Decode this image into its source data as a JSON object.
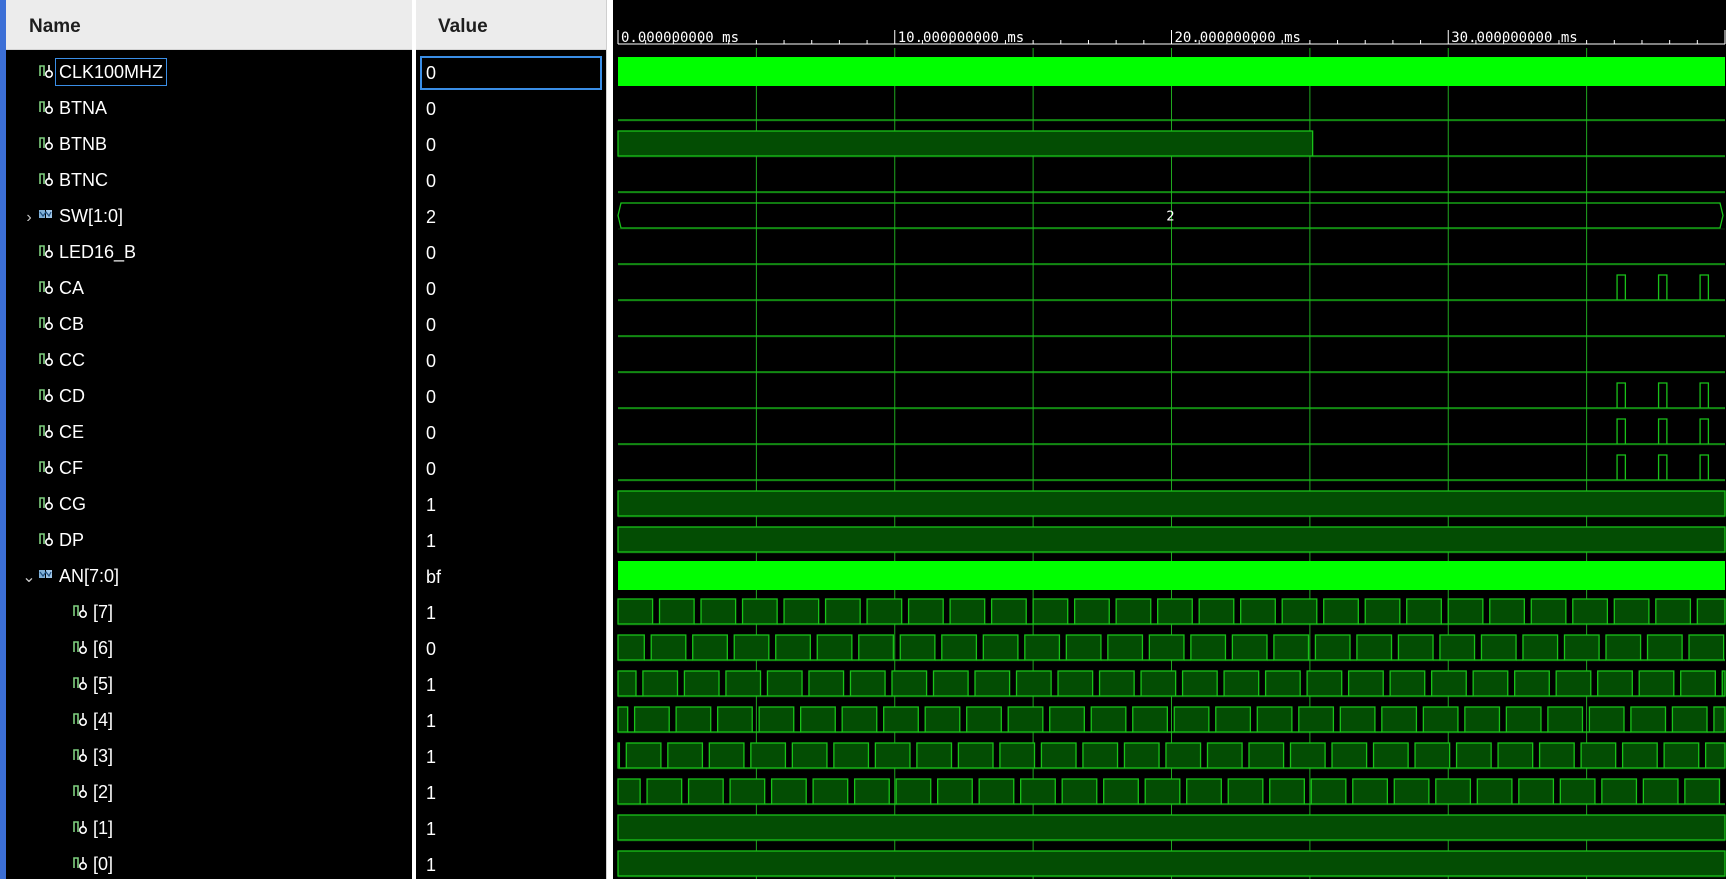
{
  "window": {
    "accent_color": "#3c6fd6"
  },
  "names_header": "Name",
  "values_header": "Value",
  "signals": [
    {
      "name": "CLK100MHZ",
      "value": "0",
      "kind": "bit",
      "icon": "signal-icon",
      "selected": true
    },
    {
      "name": "BTNA",
      "value": "0",
      "kind": "bit",
      "icon": "signal-icon"
    },
    {
      "name": "BTNB",
      "value": "0",
      "kind": "bit",
      "icon": "signal-icon"
    },
    {
      "name": "BTNC",
      "value": "0",
      "kind": "bit",
      "icon": "signal-icon"
    },
    {
      "name": "SW[1:0]",
      "value": "2",
      "kind": "bus",
      "icon": "bus-icon",
      "expander": "chevron-right-icon"
    },
    {
      "name": "LED16_B",
      "value": "0",
      "kind": "bit",
      "icon": "signal-icon"
    },
    {
      "name": "CA",
      "value": "0",
      "kind": "bit",
      "icon": "signal-icon"
    },
    {
      "name": "CB",
      "value": "0",
      "kind": "bit",
      "icon": "signal-icon"
    },
    {
      "name": "CC",
      "value": "0",
      "kind": "bit",
      "icon": "signal-icon"
    },
    {
      "name": "CD",
      "value": "0",
      "kind": "bit",
      "icon": "signal-icon"
    },
    {
      "name": "CE",
      "value": "0",
      "kind": "bit",
      "icon": "signal-icon"
    },
    {
      "name": "CF",
      "value": "0",
      "kind": "bit",
      "icon": "signal-icon"
    },
    {
      "name": "CG",
      "value": "1",
      "kind": "bit",
      "icon": "signal-icon"
    },
    {
      "name": "DP",
      "value": "1",
      "kind": "bit",
      "icon": "signal-icon"
    },
    {
      "name": "AN[7:0]",
      "value": "bf",
      "kind": "bus",
      "icon": "bus-icon",
      "expander": "chevron-down-icon"
    },
    {
      "name": "[7]",
      "value": "1",
      "kind": "bit",
      "icon": "signal-icon",
      "child": true
    },
    {
      "name": "[6]",
      "value": "0",
      "kind": "bit",
      "icon": "signal-icon",
      "child": true
    },
    {
      "name": "[5]",
      "value": "1",
      "kind": "bit",
      "icon": "signal-icon",
      "child": true
    },
    {
      "name": "[4]",
      "value": "1",
      "kind": "bit",
      "icon": "signal-icon",
      "child": true
    },
    {
      "name": "[3]",
      "value": "1",
      "kind": "bit",
      "icon": "signal-icon",
      "child": true
    },
    {
      "name": "[2]",
      "value": "1",
      "kind": "bit",
      "icon": "signal-icon",
      "child": true
    },
    {
      "name": "[1]",
      "value": "1",
      "kind": "bit",
      "icon": "signal-icon",
      "child": true
    },
    {
      "name": "[0]",
      "value": "1",
      "kind": "bit",
      "icon": "signal-icon",
      "child": true
    }
  ],
  "timeline": {
    "unit": "ms",
    "tick_labels": [
      "0.000000000 ms",
      "10.000000000 ms",
      "20.000000000 ms",
      "30.000000000 ms"
    ],
    "visible_range_ms": [
      0,
      40
    ],
    "major_step_ms": 10,
    "minor_step_ms": 1
  },
  "waveforms": {
    "colors": {
      "line": "#19c219",
      "high_fill": "#034d03",
      "dense": "#00ff00",
      "grid": "#1fa81f"
    },
    "CLK100MHZ": {
      "style": "dense"
    },
    "BTNA": {
      "style": "low"
    },
    "BTNB": {
      "style": "high_until",
      "until_ms": 25.1
    },
    "BTNC": {
      "style": "low"
    },
    "SW[1:0]": {
      "style": "bus",
      "label": "2"
    },
    "LED16_B": {
      "style": "low"
    },
    "CA": {
      "style": "pulses",
      "pulses_ms": [
        [
          36.1,
          36.4
        ],
        [
          37.6,
          37.9
        ],
        [
          39.1,
          39.4
        ]
      ]
    },
    "CB": {
      "style": "low"
    },
    "CC": {
      "style": "low"
    },
    "CD": {
      "style": "pulses",
      "pulses_ms": [
        [
          36.1,
          36.4
        ],
        [
          37.6,
          37.9
        ],
        [
          39.1,
          39.4
        ]
      ]
    },
    "CE": {
      "style": "pulses",
      "pulses_ms": [
        [
          36.1,
          36.4
        ],
        [
          37.6,
          37.9
        ],
        [
          39.1,
          39.4
        ]
      ]
    },
    "CF": {
      "style": "pulses",
      "pulses_ms": [
        [
          36.1,
          36.4
        ],
        [
          37.6,
          37.9
        ],
        [
          39.1,
          39.4
        ]
      ]
    },
    "CG": {
      "style": "high"
    },
    "DP": {
      "style": "high"
    },
    "AN[7:0]": {
      "style": "dense"
    },
    "[7]": {
      "style": "square",
      "period_ms": 1.5,
      "low_ms": 0.25,
      "phase_ms": 1.25
    },
    "[6]": {
      "style": "square",
      "period_ms": 1.5,
      "low_ms": 0.25,
      "phase_ms": 0.95
    },
    "[5]": {
      "style": "square",
      "period_ms": 1.5,
      "low_ms": 0.25,
      "phase_ms": 0.65
    },
    "[4]": {
      "style": "square",
      "period_ms": 1.5,
      "low_ms": 0.25,
      "phase_ms": 0.35
    },
    "[3]": {
      "style": "square",
      "period_ms": 1.5,
      "low_ms": 0.25,
      "phase_ms": 0.05
    },
    "[2]": {
      "style": "square",
      "period_ms": 1.5,
      "low_ms": 0.25,
      "phase_ms": 0.8
    },
    "[1]": {
      "style": "high"
    },
    "[0]": {
      "style": "high"
    }
  }
}
